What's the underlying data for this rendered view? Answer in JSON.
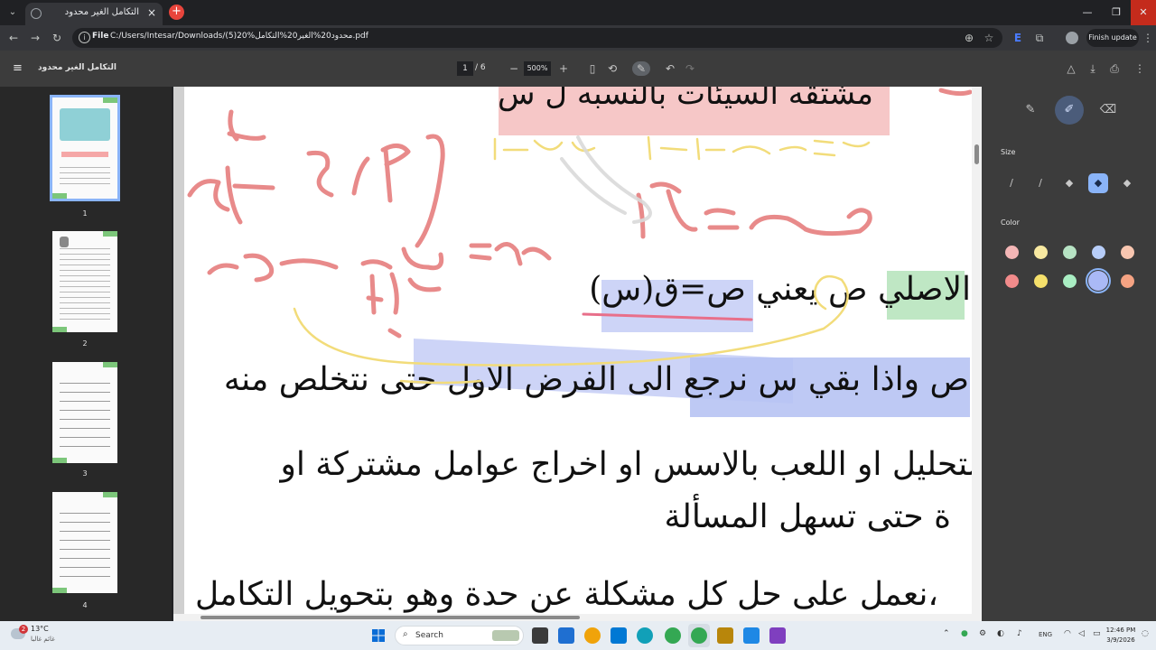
{
  "browser": {
    "tab_title": "التكامل الغير محدود",
    "url_chip": "File",
    "url": "C:/Users/Intesar/Downloads/(5)20%محدود20%الغير20%التكامل.pdf",
    "finish_update": "Finish update"
  },
  "pdf": {
    "doc_title": "التكامل الغير محدود",
    "current_page": "1",
    "total_pages": "/  6",
    "zoom": "500%",
    "thumbnails": [
      {
        "label": "1"
      },
      {
        "label": "2"
      },
      {
        "label": "3"
      },
      {
        "label": "4"
      }
    ],
    "content": {
      "line_top": "مشتقه السيئات بالنسبه ل س",
      "line1": "الاصلي ص يعني ص=ق(س)",
      "line2": "ص واذا بقي س نرجع الى الفرض الاول حتى نتخلص منه",
      "line3": "لتحليل او اللعب بالاسس او اخراج عوامل مشتركة او",
      "line4": "ة حتى تسهل المسألة",
      "line5": "،نعمل على حل كل مشكلة عن حدة وهو بتحويل التكامل"
    }
  },
  "annotation_panel": {
    "size_label": "Size",
    "color_label": "Color",
    "colors": [
      "#f4b6b6",
      "#f8e9a1",
      "#b7e3c4",
      "#b7cdf8",
      "#f8c6b0",
      "#f28b8b",
      "#f5e06b",
      "#a9eec3",
      "#aab9f6",
      "#f5a383"
    ]
  },
  "taskbar": {
    "temperature": "13°C",
    "weather_desc": "غائم غالبا",
    "search_label": "Search",
    "lang": "ENG",
    "time": "12:46 PM",
    "date": "3/9/2026",
    "badge": "2"
  }
}
